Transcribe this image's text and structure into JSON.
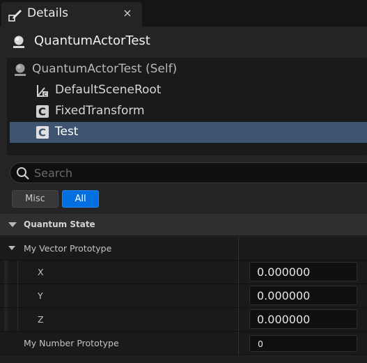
{
  "tab": {
    "title": "Details",
    "close": "×",
    "icon": "pencil-icon"
  },
  "actor": {
    "name": "QuantumActorTest",
    "icon": "actor-sphere-icon"
  },
  "tree": {
    "items": [
      {
        "label": "QuantumActorTest (Self)",
        "icon": "actor-sphere-icon"
      },
      {
        "label": "DefaultSceneRoot",
        "icon": "scene-root-icon"
      },
      {
        "label": "FixedTransform",
        "icon": "component-icon"
      },
      {
        "label": "Test",
        "icon": "component-icon"
      }
    ],
    "selected": "Test"
  },
  "search": {
    "placeholder": "Search",
    "value": ""
  },
  "filters": {
    "misc": "Misc",
    "all": "All",
    "active": "All"
  },
  "category": {
    "label": "Quantum State"
  },
  "properties": {
    "vector": {
      "label": "My Vector Prototype",
      "x_label": "X",
      "x_value": "0.000000",
      "y_label": "Y",
      "y_value": "0.000000",
      "z_label": "Z",
      "z_value": "0.000000"
    },
    "number": {
      "label": "My Number Prototype",
      "value": "0"
    }
  },
  "colors": {
    "accent": "#0070e0",
    "selection": "#3f5470",
    "panel": "#242424",
    "background": "#151515"
  }
}
